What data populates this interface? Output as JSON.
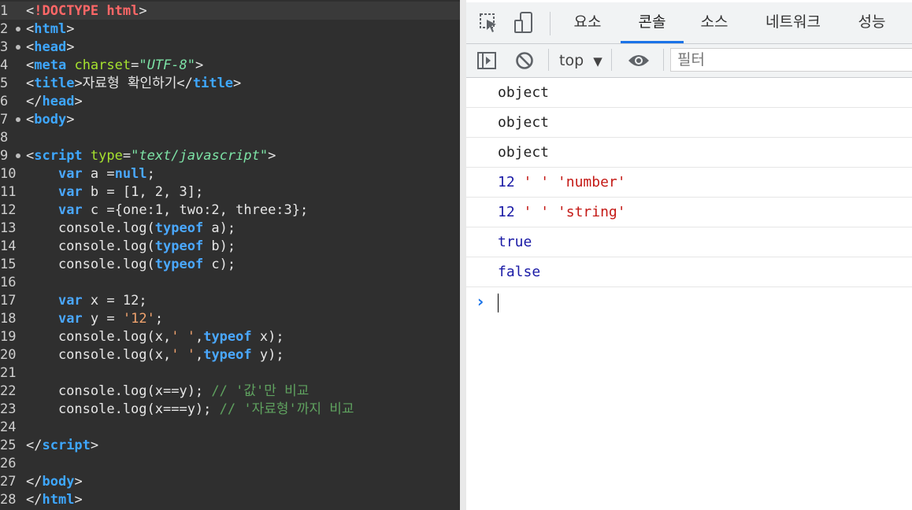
{
  "editor": {
    "lines": [
      {
        "n": "1",
        "fold": false,
        "parts": [
          [
            "tag",
            "<"
          ],
          [
            "doct",
            "!DOCTYPE html"
          ],
          [
            "tag",
            ">"
          ]
        ]
      },
      {
        "n": "2",
        "fold": true,
        "parts": [
          [
            "tag",
            "<"
          ],
          [
            "tname",
            "html"
          ],
          [
            "tag",
            ">"
          ]
        ]
      },
      {
        "n": "3",
        "fold": true,
        "parts": [
          [
            "tag",
            "<"
          ],
          [
            "tname",
            "head"
          ],
          [
            "tag",
            ">"
          ]
        ]
      },
      {
        "n": "4",
        "fold": false,
        "parts": [
          [
            "tag",
            "<"
          ],
          [
            "tname",
            "meta"
          ],
          [
            "tag",
            " "
          ],
          [
            "attr",
            "charset"
          ],
          [
            "tag",
            "="
          ],
          [
            "aval",
            "\"UTF-8\""
          ],
          [
            "tag",
            ">"
          ]
        ]
      },
      {
        "n": "5",
        "fold": false,
        "parts": [
          [
            "tag",
            "<"
          ],
          [
            "tname",
            "title"
          ],
          [
            "tag",
            ">자료형 확인하기</"
          ],
          [
            "tname",
            "title"
          ],
          [
            "tag",
            ">"
          ]
        ]
      },
      {
        "n": "6",
        "fold": false,
        "parts": [
          [
            "tag",
            "</"
          ],
          [
            "tname",
            "head"
          ],
          [
            "tag",
            ">"
          ]
        ]
      },
      {
        "n": "7",
        "fold": true,
        "parts": [
          [
            "tag",
            "<"
          ],
          [
            "tname",
            "body"
          ],
          [
            "tag",
            ">"
          ]
        ]
      },
      {
        "n": "8",
        "fold": false,
        "parts": []
      },
      {
        "n": "9",
        "fold": true,
        "parts": [
          [
            "tag",
            "<"
          ],
          [
            "tname",
            "script"
          ],
          [
            "tag",
            " "
          ],
          [
            "attr",
            "type"
          ],
          [
            "tag",
            "="
          ],
          [
            "aval",
            "\"text/javascript\""
          ],
          [
            "tag",
            ">"
          ]
        ]
      },
      {
        "n": "10",
        "fold": false,
        "parts": [
          [
            "tag",
            "    "
          ],
          [
            "kw",
            "var"
          ],
          [
            "tag",
            " a ="
          ],
          [
            "kw",
            "null"
          ],
          [
            "tag",
            ";"
          ]
        ]
      },
      {
        "n": "11",
        "fold": false,
        "parts": [
          [
            "tag",
            "    "
          ],
          [
            "kw",
            "var"
          ],
          [
            "tag",
            " b = [1, 2, 3];"
          ]
        ]
      },
      {
        "n": "12",
        "fold": false,
        "parts": [
          [
            "tag",
            "    "
          ],
          [
            "kw",
            "var"
          ],
          [
            "tag",
            " c ={one:1, two:2, three:3};"
          ]
        ]
      },
      {
        "n": "13",
        "fold": false,
        "parts": [
          [
            "tag",
            "    console.log("
          ],
          [
            "kw",
            "typeof"
          ],
          [
            "tag",
            " a);"
          ]
        ]
      },
      {
        "n": "14",
        "fold": false,
        "parts": [
          [
            "tag",
            "    console.log("
          ],
          [
            "kw",
            "typeof"
          ],
          [
            "tag",
            " b);"
          ]
        ]
      },
      {
        "n": "15",
        "fold": false,
        "parts": [
          [
            "tag",
            "    console.log("
          ],
          [
            "kw",
            "typeof"
          ],
          [
            "tag",
            " c);"
          ]
        ]
      },
      {
        "n": "16",
        "fold": false,
        "parts": []
      },
      {
        "n": "17",
        "fold": false,
        "parts": [
          [
            "tag",
            "    "
          ],
          [
            "kw",
            "var"
          ],
          [
            "tag",
            " x = 12;"
          ]
        ]
      },
      {
        "n": "18",
        "fold": false,
        "parts": [
          [
            "tag",
            "    "
          ],
          [
            "kw",
            "var"
          ],
          [
            "tag",
            " y = "
          ],
          [
            "str",
            "'12'"
          ],
          [
            "tag",
            ";"
          ]
        ]
      },
      {
        "n": "19",
        "fold": false,
        "parts": [
          [
            "tag",
            "    console.log(x,"
          ],
          [
            "str",
            "' '"
          ],
          [
            "tag",
            ","
          ],
          [
            "kw",
            "typeof"
          ],
          [
            "tag",
            " x);"
          ]
        ]
      },
      {
        "n": "20",
        "fold": false,
        "parts": [
          [
            "tag",
            "    console.log(x,"
          ],
          [
            "str",
            "' '"
          ],
          [
            "tag",
            ","
          ],
          [
            "kw",
            "typeof"
          ],
          [
            "tag",
            " y);"
          ]
        ]
      },
      {
        "n": "21",
        "fold": false,
        "parts": []
      },
      {
        "n": "22",
        "fold": false,
        "parts": [
          [
            "tag",
            "    console.log(x==y); "
          ],
          [
            "cmt",
            "// '값'만 비교"
          ]
        ]
      },
      {
        "n": "23",
        "fold": false,
        "parts": [
          [
            "tag",
            "    console.log(x===y); "
          ],
          [
            "cmt",
            "// '자료형'까지 비교"
          ]
        ]
      },
      {
        "n": "24",
        "fold": false,
        "parts": []
      },
      {
        "n": "25",
        "fold": false,
        "parts": [
          [
            "tag",
            "</"
          ],
          [
            "tname",
            "script"
          ],
          [
            "tag",
            ">"
          ]
        ]
      },
      {
        "n": "26",
        "fold": false,
        "parts": []
      },
      {
        "n": "27",
        "fold": false,
        "parts": [
          [
            "tag",
            "</"
          ],
          [
            "tname",
            "body"
          ],
          [
            "tag",
            ">"
          ]
        ]
      },
      {
        "n": "28",
        "fold": false,
        "parts": [
          [
            "tag",
            "</"
          ],
          [
            "tname",
            "html"
          ],
          [
            "tag",
            ">"
          ]
        ]
      }
    ]
  },
  "devtools": {
    "tabs": [
      "요소",
      "콘솔",
      "소스",
      "네트워크",
      "성능"
    ],
    "active_tab": "콘솔",
    "toolbar": {
      "context": "top",
      "context_arrow": "▼",
      "filter_placeholder": "필터",
      "icons": [
        "inspect-element-icon",
        "device-toolbar-icon",
        "show-sidebar-icon",
        "clear-console-icon",
        "live-expression-eye-icon"
      ]
    },
    "console_messages": [
      [
        [
          "plain",
          "object"
        ]
      ],
      [
        [
          "plain",
          "object"
        ]
      ],
      [
        [
          "plain",
          "object"
        ]
      ],
      [
        [
          "num",
          "12"
        ],
        [
          "plain",
          " "
        ],
        [
          "cstr",
          "' '"
        ],
        [
          "plain",
          " "
        ],
        [
          "cstr",
          "'number'"
        ]
      ],
      [
        [
          "num",
          "12"
        ],
        [
          "plain",
          " "
        ],
        [
          "cstr",
          "' '"
        ],
        [
          "plain",
          " "
        ],
        [
          "cstr",
          "'string'"
        ]
      ],
      [
        [
          "bool",
          "true"
        ]
      ],
      [
        [
          "bool",
          "false"
        ]
      ]
    ],
    "prompt_symbol": "›"
  }
}
